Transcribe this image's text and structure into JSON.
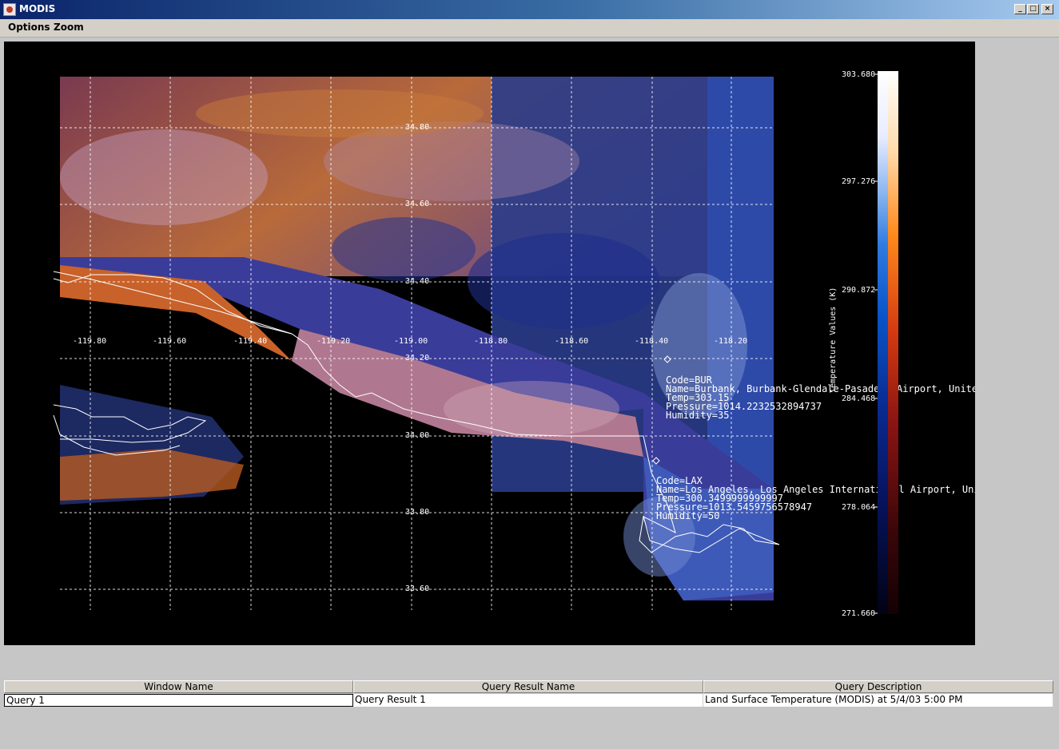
{
  "window": {
    "title": "MODIS"
  },
  "menubar": {
    "items": [
      "Options",
      "Zoom"
    ]
  },
  "map": {
    "lon_labels": [
      "-119.80",
      "-119.60",
      "-119.40",
      "-119.20",
      "-119.00",
      "-118.80",
      "-118.60",
      "-118.40",
      "-118.20"
    ],
    "lat_labels": [
      "34.80",
      "34.60",
      "34.40",
      "34.20",
      "34.00",
      "33.80",
      "33.60"
    ],
    "stations": [
      {
        "code": "Code=BUR",
        "name": "Name=Burbank, Burbank-Glendale-Pasadena Airport, United",
        "temp": "Temp=303.15",
        "pressure": "Pressure=1014.2232532894737",
        "humidity": "Humidity=35"
      },
      {
        "code": "Code=LAX",
        "name": "Name=Los Angeles, Los Angeles International Airport, United St",
        "temp": "Temp=300.3499999999997",
        "pressure": "Pressure=1013.5459756578947",
        "humidity": "Humidity=50"
      }
    ]
  },
  "colorbar": {
    "title": "Temperature Values (K)",
    "ticks": [
      "303.680",
      "297.276",
      "290.872",
      "284.468",
      "278.064",
      "271.660"
    ]
  },
  "table": {
    "headers": [
      "Window Name",
      "Query Result Name",
      "Query Description"
    ],
    "rows": [
      [
        "Query 1",
        "Query Result 1",
        "Land Surface Temperature (MODIS) at 5/4/03 5:00 PM"
      ]
    ]
  }
}
